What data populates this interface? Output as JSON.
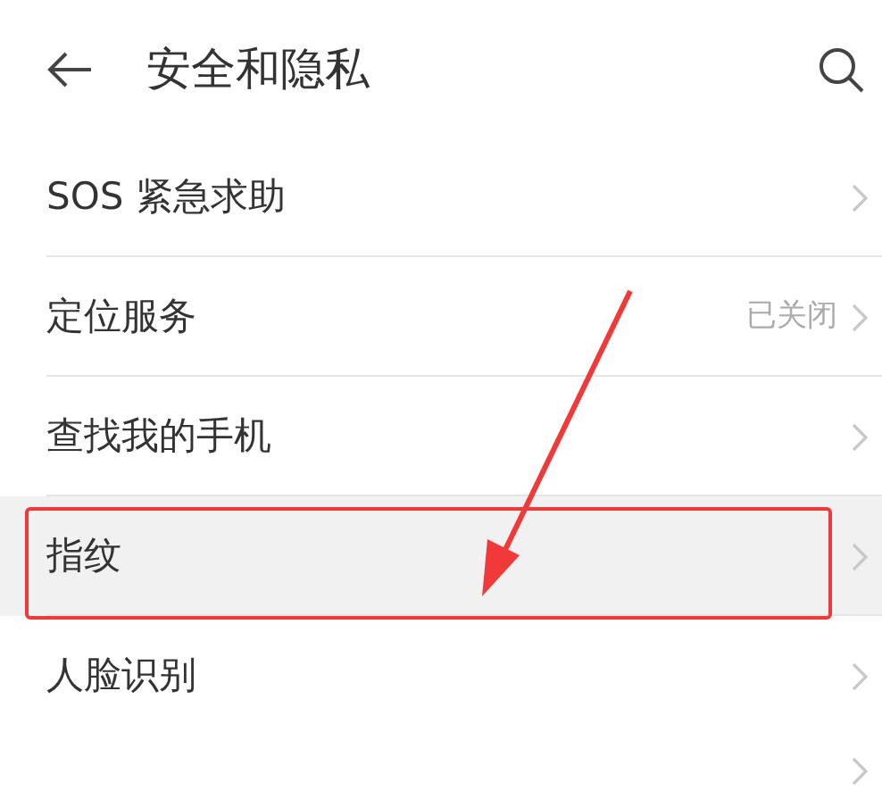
{
  "header": {
    "title": "安全和隐私"
  },
  "items": [
    {
      "kind": "row",
      "label": "SOS 紧急求助",
      "selected": false,
      "annotated": false
    },
    {
      "kind": "row",
      "label": "定位服务",
      "value": "已关闭",
      "selected": false,
      "annotated": false
    },
    {
      "kind": "row",
      "label": "查找我的手机",
      "selected": false,
      "annotated": false
    },
    {
      "kind": "row",
      "label": "指纹",
      "selected": true,
      "annotated": true
    },
    {
      "kind": "row",
      "label": "人脸识别",
      "selected": false,
      "annotated": false
    },
    {
      "kind": "partial",
      "selected": false,
      "annotated": false
    }
  ]
}
